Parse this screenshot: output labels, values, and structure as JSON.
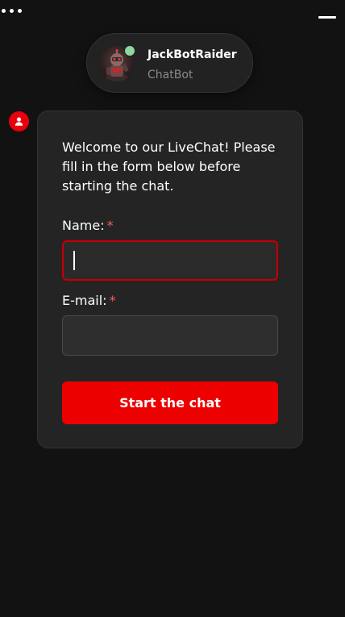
{
  "header": {
    "more_icon": "more-horizontal-icon",
    "minimize_icon": "minimize-icon"
  },
  "bot": {
    "name": "JackBotRaider",
    "role": "ChatBot",
    "status_color": "#8fd6a0",
    "avatar_icon": "robot-avatar-icon"
  },
  "message": {
    "sender_icon": "user-icon",
    "welcome_text": "Welcome to our LiveChat! Please fill in the form below before starting the chat."
  },
  "form": {
    "name_label": "Name:",
    "name_required": "*",
    "name_value": "",
    "email_label": "E-mail:",
    "email_required": "*",
    "email_value": "",
    "submit_label": "Start the chat"
  },
  "colors": {
    "accent": "#ec0000",
    "background": "#121212",
    "card": "#242424"
  }
}
